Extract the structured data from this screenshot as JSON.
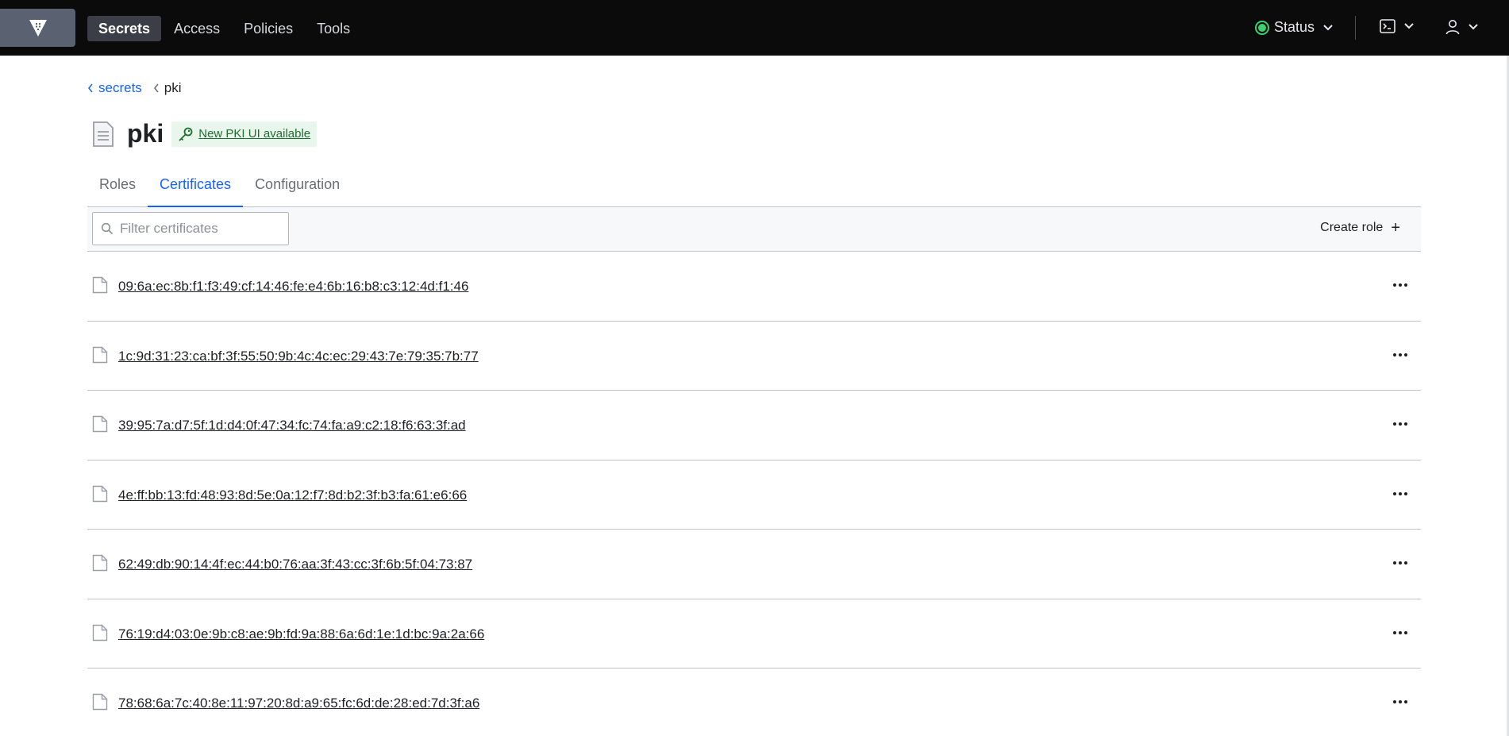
{
  "nav": {
    "links": [
      {
        "label": "Secrets",
        "active": true
      },
      {
        "label": "Access",
        "active": false
      },
      {
        "label": "Policies",
        "active": false
      },
      {
        "label": "Tools",
        "active": false
      }
    ],
    "status_label": "Status",
    "status_color": "#3bd16f"
  },
  "breadcrumb": {
    "parent": "secrets",
    "current": "pki"
  },
  "page": {
    "title": "pki",
    "badge_label": "New PKI UI available"
  },
  "tabs": [
    {
      "label": "Roles",
      "active": false
    },
    {
      "label": "Certificates",
      "active": true
    },
    {
      "label": "Configuration",
      "active": false
    }
  ],
  "toolbar": {
    "filter_placeholder": "Filter certificates",
    "filter_value": "",
    "create_label": "Create role"
  },
  "certificates": [
    "09:6a:ec:8b:f1:f3:49:cf:14:46:fe:e4:6b:16:b8:c3:12:4d:f1:46",
    "1c:9d:31:23:ca:bf:3f:55:50:9b:4c:4c:ec:29:43:7e:79:35:7b:77",
    "39:95:7a:d7:5f:1d:d4:0f:47:34:fc:74:fa:a9:c2:18:f6:63:3f:ad",
    "4e:ff:bb:13:fd:48:93:8d:5e:0a:12:f7:8d:b2:3f:b3:fa:61:e6:66",
    "62:49:db:90:14:4f:ec:44:b0:76:aa:3f:43:cc:3f:6b:5f:04:73:87",
    "76:19:d4:03:0e:9b:c8:ae:9b:fd:9a:88:6a:6d:1e:1d:bc:9a:2a:66",
    "78:68:6a:7c:40:8e:11:97:20:8d:a9:65:fc:6d:de:28:ed:7d:3f:a6"
  ],
  "colors": {
    "accent": "#1563ff",
    "nav_bg": "#0b0b0c",
    "badge_bg": "#e9f6ec",
    "badge_text": "#1f6e31"
  },
  "icons": {
    "logo": "vault-logo-icon",
    "console": "terminal-icon",
    "user": "user-icon",
    "row": "file-icon",
    "row_menu": "more-horizontal-icon",
    "search": "search-icon",
    "create": "plus-icon",
    "badge": "key-icon",
    "page": "document-icon"
  }
}
